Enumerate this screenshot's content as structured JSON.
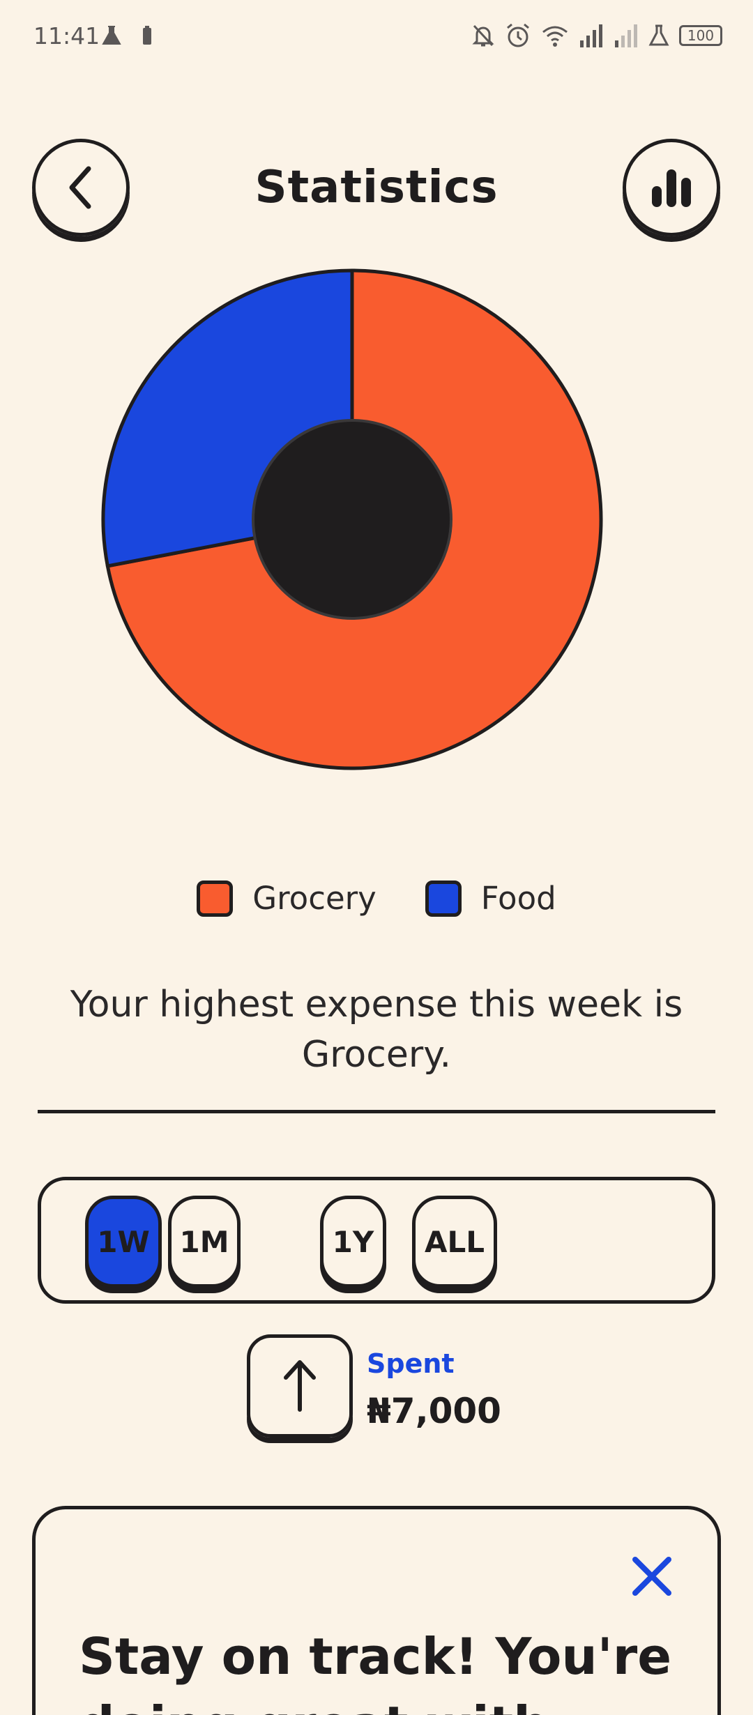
{
  "status_bar": {
    "time": "11:41",
    "battery": "100",
    "icons": [
      "flask-icon",
      "battery-small-icon",
      "bell-off-icon",
      "alarm-icon",
      "wifi-icon",
      "signal-icon",
      "signal-weak-icon",
      "flask-icon",
      "battery-icon"
    ]
  },
  "header": {
    "title": "Statistics",
    "back_icon": "chevron-left-icon",
    "stats_icon": "bar-chart-icon"
  },
  "chart_data": {
    "type": "pie",
    "style": "donut",
    "title": "",
    "slices": [
      {
        "label": "Grocery",
        "value": 72,
        "color": "#f95c2f"
      },
      {
        "label": "Food",
        "value": 28,
        "color": "#1a47de"
      }
    ],
    "hole_color": "#1f1d1e",
    "legend_position": "bottom"
  },
  "legend": [
    {
      "label": "Grocery",
      "color": "#f95c2f"
    },
    {
      "label": "Food",
      "color": "#1a47de"
    }
  ],
  "insight": {
    "line1": "Your highest expense this week is",
    "line2": "Grocery."
  },
  "timeframe": {
    "options": [
      "1W",
      "1M",
      "1Y",
      "ALL"
    ],
    "selected": "1W"
  },
  "spent": {
    "label": "Spent",
    "amount": "₦7,000",
    "icon": "arrow-up-icon"
  },
  "promo_card": {
    "text": "Stay on track! You're doing great with",
    "close_icon": "close-icon"
  },
  "colors": {
    "background": "#fbf3e7",
    "accent_orange": "#f95c2f",
    "accent_blue": "#1a47de",
    "ink": "#1f1d1e"
  }
}
